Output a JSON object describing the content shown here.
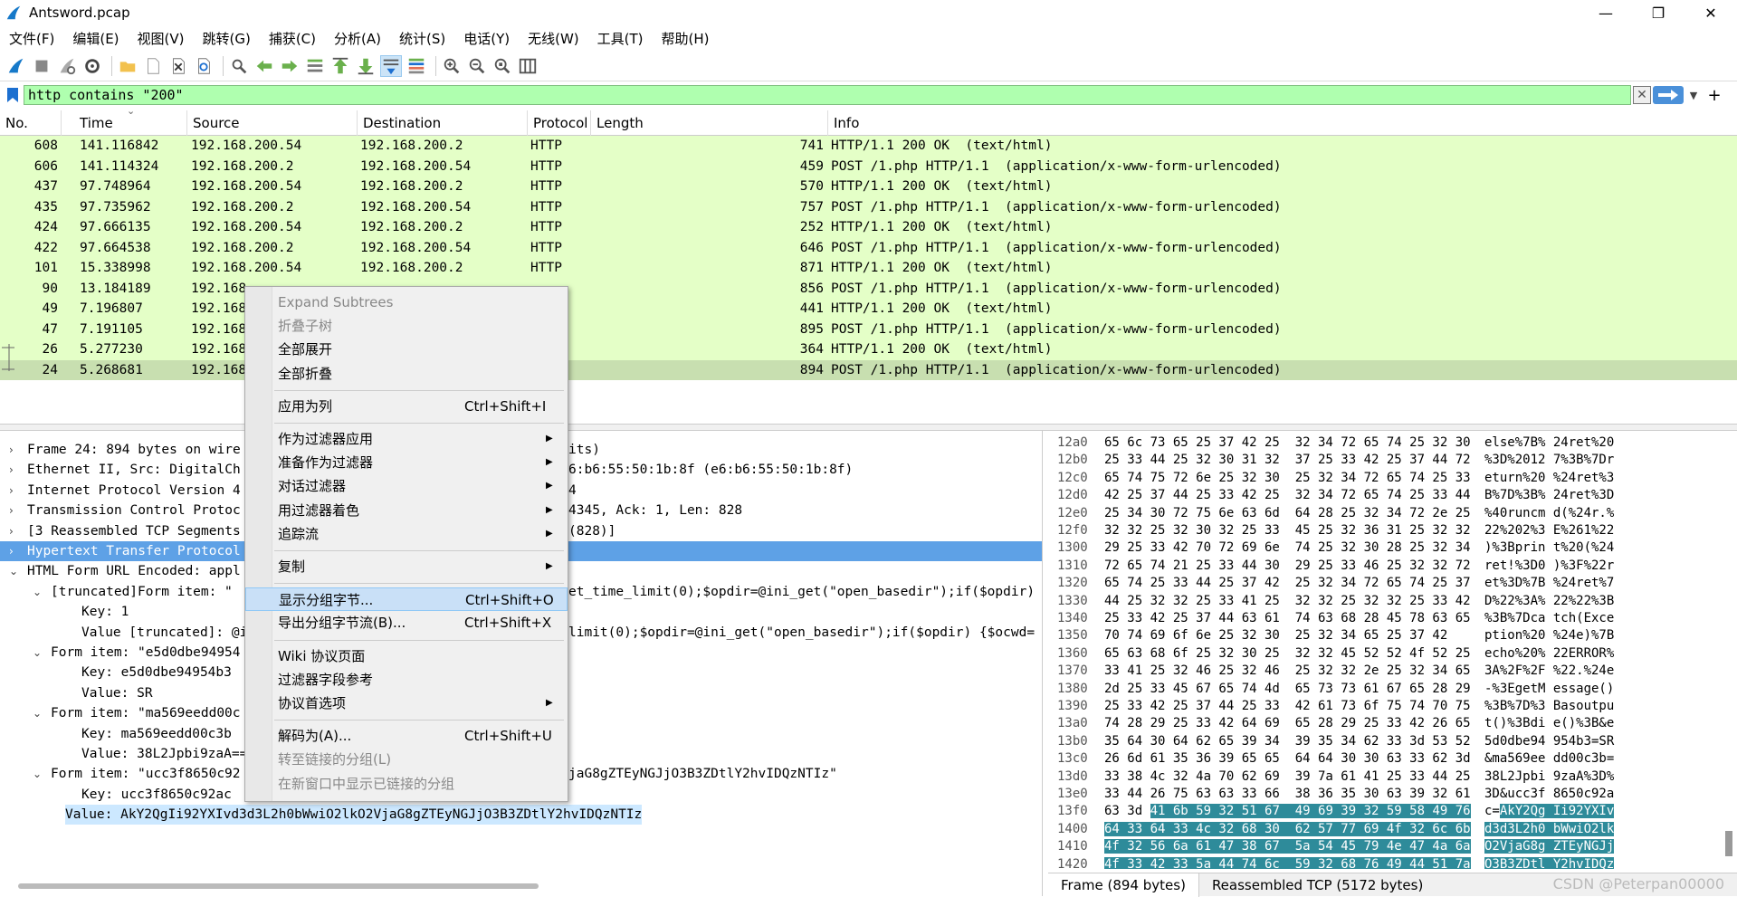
{
  "window": {
    "title": "Antsword.pcap",
    "minimize": "—",
    "maximize": "❐",
    "close": "✕"
  },
  "menubar": [
    "文件(F)",
    "编辑(E)",
    "视图(V)",
    "跳转(G)",
    "捕获(C)",
    "分析(A)",
    "统计(S)",
    "电话(Y)",
    "无线(W)",
    "工具(T)",
    "帮助(H)"
  ],
  "toolbar": {
    "icons": [
      "shark-fin-start-icon",
      "stop-icon",
      "restart-icon",
      "options-gear-icon",
      "sep",
      "open-folder-icon",
      "save-file-icon",
      "close-file-icon",
      "reload-icon",
      "sep",
      "find-icon",
      "back-arrow-icon",
      "forward-arrow-icon",
      "goto-packet-icon",
      "first-packet-icon",
      "last-packet-icon",
      "autoscroll-icon",
      "colorize-icon",
      "sep",
      "zoom-in-icon",
      "zoom-out-icon",
      "zoom-normal-icon",
      "resize-columns-icon"
    ],
    "active_index": 16
  },
  "filter": {
    "value": "http contains \"200\"",
    "clear": "✕",
    "add": "+",
    "dropdown": "▼"
  },
  "packet_list": {
    "columns": [
      "No.",
      "Time",
      "Source",
      "Destination",
      "Protocol",
      "Length",
      "Info"
    ],
    "sort_indicator": "⌄",
    "rows": [
      {
        "no": "608",
        "time": "141.116842",
        "src": "192.168.200.54",
        "dst": "192.168.200.2",
        "proto": "HTTP",
        "len": "741",
        "info": "HTTP/1.1 200 OK  (text/html)"
      },
      {
        "no": "606",
        "time": "141.114324",
        "src": "192.168.200.2",
        "dst": "192.168.200.54",
        "proto": "HTTP",
        "len": "459",
        "info": "POST /1.php HTTP/1.1  (application/x-www-form-urlencoded)"
      },
      {
        "no": "437",
        "time": "97.748964",
        "src": "192.168.200.54",
        "dst": "192.168.200.2",
        "proto": "HTTP",
        "len": "570",
        "info": "HTTP/1.1 200 OK  (text/html)"
      },
      {
        "no": "435",
        "time": "97.735962",
        "src": "192.168.200.2",
        "dst": "192.168.200.54",
        "proto": "HTTP",
        "len": "757",
        "info": "POST /1.php HTTP/1.1  (application/x-www-form-urlencoded)"
      },
      {
        "no": "424",
        "time": "97.666135",
        "src": "192.168.200.54",
        "dst": "192.168.200.2",
        "proto": "HTTP",
        "len": "252",
        "info": "HTTP/1.1 200 OK  (text/html)"
      },
      {
        "no": "422",
        "time": "97.664538",
        "src": "192.168.200.2",
        "dst": "192.168.200.54",
        "proto": "HTTP",
        "len": "646",
        "info": "POST /1.php HTTP/1.1  (application/x-www-form-urlencoded)"
      },
      {
        "no": "101",
        "time": "15.338998",
        "src": "192.168.200.54",
        "dst": "192.168.200.2",
        "proto": "HTTP",
        "len": "871",
        "info": "HTTP/1.1 200 OK  (text/html)"
      },
      {
        "no": "90",
        "time": "13.184189",
        "src": "192.168",
        "dst": "",
        "proto": "",
        "len": "856",
        "info": "POST /1.php HTTP/1.1  (application/x-www-form-urlencoded)"
      },
      {
        "no": "49",
        "time": "7.196807",
        "src": "192.168",
        "dst": "",
        "proto": "",
        "len": "441",
        "info": "HTTP/1.1 200 OK  (text/html)"
      },
      {
        "no": "47",
        "time": "7.191105",
        "src": "192.168",
        "dst": "",
        "proto": "",
        "len": "895",
        "info": "POST /1.php HTTP/1.1  (application/x-www-form-urlencoded)"
      },
      {
        "no": "26",
        "time": "5.277230",
        "src": "192.168",
        "dst": "",
        "proto": "",
        "len": "364",
        "info": "HTTP/1.1 200 OK  (text/html)"
      },
      {
        "no": "24",
        "time": "5.268681",
        "src": "192.168",
        "dst": "",
        "proto": "",
        "len": "894",
        "info": "POST /1.php HTTP/1.1  (application/x-www-form-urlencoded)"
      }
    ],
    "selected_index": 11
  },
  "details": [
    {
      "indent": 0,
      "arrow": "›",
      "left": "Frame 24: 894 bytes on wire",
      "right": "its)"
    },
    {
      "indent": 0,
      "arrow": "›",
      "left": "Ethernet II, Src: DigitalCh",
      "right": "6:b6:55:50:1b:8f (e6:b6:55:50:1b:8f)"
    },
    {
      "indent": 0,
      "arrow": "›",
      "left": "Internet Protocol Version 4",
      "right": "4"
    },
    {
      "indent": 0,
      "arrow": "›",
      "left": "Transmission Control Protoc",
      "right": "4345, Ack: 1, Len: 828"
    },
    {
      "indent": 0,
      "arrow": "›",
      "left": "[3 Reassembled TCP Segments",
      "right": "(828)]"
    },
    {
      "indent": 0,
      "arrow": "›",
      "left": "Hypertext Transfer Protocol",
      "right": "",
      "hl": true
    },
    {
      "indent": 0,
      "arrow": "⌄",
      "left": "HTML Form URL Encoded: appl",
      "right": ""
    },
    {
      "indent": 1,
      "arrow": "⌄",
      "left": "[truncated]Form item: \"",
      "right": "et_time_limit(0);$opdir=@ini_get(\"open_basedir\");if($opdir)"
    },
    {
      "indent": 2,
      "arrow": "",
      "left": "Key: 1",
      "right": ""
    },
    {
      "indent": 2,
      "arrow": "",
      "left": "Value [truncated]: @i",
      "right": "limit(0);$opdir=@ini_get(\"open_basedir\");if($opdir) {$ocwd="
    },
    {
      "indent": 1,
      "arrow": "⌄",
      "left": "Form item: \"e5d0dbe94954",
      "right": ""
    },
    {
      "indent": 2,
      "arrow": "",
      "left": "Key: e5d0dbe94954b3",
      "right": ""
    },
    {
      "indent": 2,
      "arrow": "",
      "left": "Value: SR",
      "right": ""
    },
    {
      "indent": 1,
      "arrow": "⌄",
      "left": "Form item: \"ma569eedd00c",
      "right": ""
    },
    {
      "indent": 2,
      "arrow": "",
      "left": "Key: ma569eedd00c3b",
      "right": ""
    },
    {
      "indent": 2,
      "arrow": "",
      "left": "Value: 38L2Jpbi9zaA==",
      "right": ""
    },
    {
      "indent": 1,
      "arrow": "⌄",
      "left": "Form item: \"ucc3f8650c92",
      "right": "jaG8gZTEyNGJjO3B3ZDtlY2hvIDQzNTIz\""
    },
    {
      "indent": 2,
      "arrow": "",
      "left": "Key: ucc3f8650c92ac",
      "right": ""
    },
    {
      "indent": 2,
      "arrow": "",
      "left": "Value: AkY2QgIi92YXIvd3d3L2h0bWwiO2lkO2VjaG8gZTEyNGJjO3B3ZDtlY2hvIDQzNTIz",
      "right": "",
      "sel": true
    }
  ],
  "hex": [
    {
      "off": "12a0",
      "hex": "65 6c 73 65 25 37 42 25  32 34 72 65 74 25 32 30",
      "asc": "else%7B% 24ret%20"
    },
    {
      "off": "12b0",
      "hex": "25 33 44 25 32 30 31 32  37 25 33 42 25 37 44 72",
      "asc": "%3D%2012 7%3B%7Dr"
    },
    {
      "off": "12c0",
      "hex": "65 74 75 72 6e 25 32 30  25 32 34 72 65 74 25 33",
      "asc": "eturn%20 %24ret%3"
    },
    {
      "off": "12d0",
      "hex": "42 25 37 44 25 33 42 25  32 34 72 65 74 25 33 44",
      "asc": "B%7D%3B% 24ret%3D"
    },
    {
      "off": "12e0",
      "hex": "25 34 30 72 75 6e 63 6d  64 28 25 32 34 72 2e 25",
      "asc": "%40runcm d(%24r.%"
    },
    {
      "off": "12f0",
      "hex": "32 32 25 32 30 32 25 33  45 25 32 36 31 25 32 32",
      "asc": "22%202%3 E%261%22"
    },
    {
      "off": "1300",
      "hex": "29 25 33 42 70 72 69 6e  74 25 32 30 28 25 32 34",
      "asc": ")%3Bprin t%20(%24"
    },
    {
      "off": "1310",
      "hex": "72 65 74 21 25 33 44 30  29 25 33 46 25 32 32 72",
      "asc": "ret!%3D0 )%3F%22r"
    },
    {
      "off": "1320",
      "hex": "65 74 25 33 44 25 37 42  25 32 34 72 65 74 25 37",
      "asc": "et%3D%7B %24ret%7"
    },
    {
      "off": "1330",
      "hex": "44 25 32 32 25 33 41 25  32 32 25 32 32 25 33 42",
      "asc": "D%22%3A% 22%22%3B"
    },
    {
      "off": "1340",
      "hex": "25 33 42 25 37 44 63 61  74 63 68 28 45 78 63 65",
      "asc": "%3B%7Dca tch(Exce"
    },
    {
      "off": "1350",
      "hex": "70 74 69 6f 6e 25 32 30  25 32 34 65 25 37 42",
      "asc": "ption%20 %24e)%7B"
    },
    {
      "off": "1360",
      "hex": "65 63 68 6f 25 32 30 25  32 32 45 52 52 4f 52 25",
      "asc": "echo%20% 22ERROR%"
    },
    {
      "off": "1370",
      "hex": "33 41 25 32 46 25 32 46  25 32 32 2e 25 32 34 65",
      "asc": "3A%2F%2F %22.%24e"
    },
    {
      "off": "1380",
      "hex": "2d 25 33 45 67 65 74 4d  65 73 73 61 67 65 28 29",
      "asc": "-%3EgetM essage()"
    },
    {
      "off": "1390",
      "hex": "25 33 42 25 37 44 25 33  42 61 73 6f 75 74 70 75",
      "asc": "%3B%7D%3 Basoutpu"
    },
    {
      "off": "13a0",
      "hex": "74 28 29 25 33 42 64 69  65 28 29 25 33 42 26 65",
      "asc": "t()%3Bdi e()%3B&e"
    },
    {
      "off": "13b0",
      "hex": "35 64 30 64 62 65 39 34  39 35 34 62 33 3d 53 52",
      "asc": "5d0dbe94 954b3=SR"
    },
    {
      "off": "13c0",
      "hex": "26 6d 61 35 36 39 65 65  64 64 30 30 63 33 62 3d",
      "asc": "&ma569ee dd00c3b="
    },
    {
      "off": "13d0",
      "hex": "33 38 4c 32 4a 70 62 69  39 7a 61 41 25 33 44 25",
      "asc": "38L2Jpbi 9zaA%3D%"
    },
    {
      "off": "13e0",
      "hex": "33 44 26 75 63 63 33 66  38 36 35 30 63 39 32 61",
      "asc": "3D&ucc3f 8650c92a"
    },
    {
      "off": "13f0",
      "hexA": "63 3d ",
      "hexB": "41 6b 59 32 51 67  49 69 39 32 59 58 49 76",
      "ascA": "c=",
      "ascB": "AkY2Qg Ii92YXIv"
    },
    {
      "off": "1400",
      "hexB": "64 33 64 33 4c 32 68 30  62 57 77 69 4f 32 6c 6b",
      "ascB": "d3d3L2h0 bWwiO2lk"
    },
    {
      "off": "1410",
      "hexB": "4f 32 56 6a 61 47 38 67  5a 54 45 79 4e 47 4a 6a",
      "ascB": "O2VjaG8g ZTEyNGJj"
    },
    {
      "off": "1420",
      "hexB": "4f 33 42 33 5a 44 74 6c  59 32 68 76 49 44 51 7a",
      "ascB": "O3B3ZDtl Y2hvIDQz"
    },
    {
      "off": "1430",
      "hexB": "4e 54 49 7a",
      "ascB": "NTIz"
    }
  ],
  "bottom_tabs": [
    "Frame (894 bytes)",
    "Reassembled TCP (5172 bytes)"
  ],
  "watermark": "CSDN @Peterpan00000",
  "context_menu": [
    {
      "label": "Expand Subtrees",
      "disabled": true
    },
    {
      "label": "折叠子树",
      "disabled": true
    },
    {
      "label": "全部展开"
    },
    {
      "label": "全部折叠"
    },
    {
      "sep": true
    },
    {
      "label": "应用为列",
      "shortcut": "Ctrl+Shift+I"
    },
    {
      "sep": true
    },
    {
      "label": "作为过滤器应用",
      "submenu": true
    },
    {
      "label": "准备作为过滤器",
      "submenu": true
    },
    {
      "label": "对话过滤器",
      "submenu": true
    },
    {
      "label": "用过滤器着色",
      "submenu": true
    },
    {
      "label": "追踪流",
      "submenu": true
    },
    {
      "sep": true
    },
    {
      "label": "复制",
      "submenu": true
    },
    {
      "sep": true
    },
    {
      "label": "显示分组字节...",
      "shortcut": "Ctrl+Shift+O",
      "hover": true
    },
    {
      "label": "导出分组字节流(B)...",
      "shortcut": "Ctrl+Shift+X"
    },
    {
      "sep": true
    },
    {
      "label": "Wiki 协议页面"
    },
    {
      "label": "过滤器字段参考"
    },
    {
      "label": "协议首选项",
      "submenu": true
    },
    {
      "sep": true
    },
    {
      "label": "解码为(A)...",
      "shortcut": "Ctrl+Shift+U"
    },
    {
      "label": "转至链接的分组(L)",
      "disabled": true
    },
    {
      "label": "在新窗口中显示已链接的分组",
      "disabled": true
    }
  ],
  "submenu_arrow": "▶"
}
